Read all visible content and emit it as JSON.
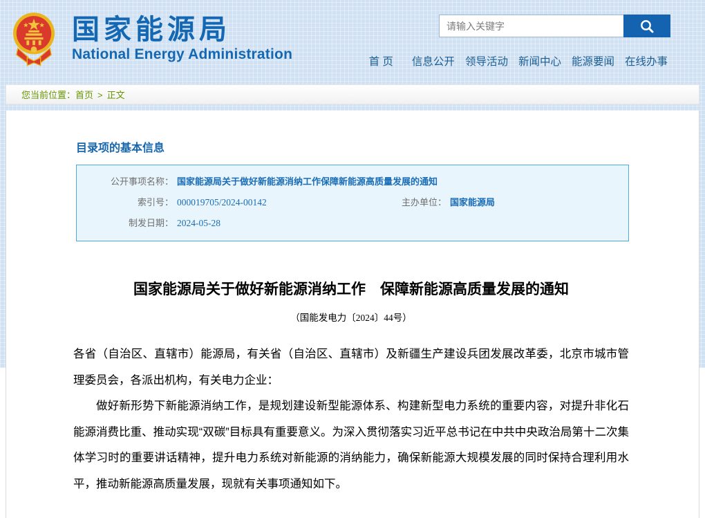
{
  "header": {
    "site_title_cn": "国家能源局",
    "site_title_en": "National Energy Administration",
    "search": {
      "placeholder": "请输入关键字"
    },
    "nav": [
      {
        "label": "首 页"
      },
      {
        "label": "信息公开"
      },
      {
        "label": "领导活动"
      },
      {
        "label": "新闻中心"
      },
      {
        "label": "能源要闻"
      },
      {
        "label": "在线办事"
      }
    ]
  },
  "breadcrumb": {
    "prefix": "您当前位置：",
    "home": "首页",
    "separator": ">",
    "current": "正文"
  },
  "content": {
    "section_title": "目录项的基本信息",
    "info_table": {
      "name_label": "公开事项名称：",
      "name_value": "国家能源局关于做好新能源消纳工作保障新能源高质量发展的通知",
      "index_label": "索引号：",
      "index_value": "000019705/2024-00142",
      "org_label": "主办单位：",
      "org_value": "国家能源局",
      "date_label": "制发日期：",
      "date_value": "2024-05-28"
    },
    "article": {
      "title": "国家能源局关于做好新能源消纳工作　保障新能源高质量发展的通知",
      "doc_number": "（国能发电力〔2024〕44号）",
      "paragraphs": [
        "各省（自治区、直辖市）能源局，有关省（自治区、直辖市）及新疆生产建设兵团发展改革委，北京市城市管理委员会，各派出机构，有关电力企业：",
        "做好新形势下新能源消纳工作，是规划建设新型能源体系、构建新型电力系统的重要内容，对提升非化石能源消费比重、推动实现“双碳”目标具有重要意义。为深入贯彻落实习近平总书记在中共中央政治局第十二次集体学习时的重要讲话精神，提升电力系统对新能源的消纳能力，确保新能源大规模发展的同时保持合理利用水平，推动新能源高质量发展，现就有关事项通知如下。"
      ]
    }
  },
  "colors": {
    "brand_blue": "#1467b2",
    "nav_blue": "#1c5e93",
    "search_button_blue": "#1463b0",
    "breadcrumb_green": "#689600",
    "info_box_bg": "#e9f5fd",
    "info_box_border": "#51a8d8",
    "info_value_blue": "#1a6db5",
    "header_plaid_bg": "#cfe1f2"
  }
}
